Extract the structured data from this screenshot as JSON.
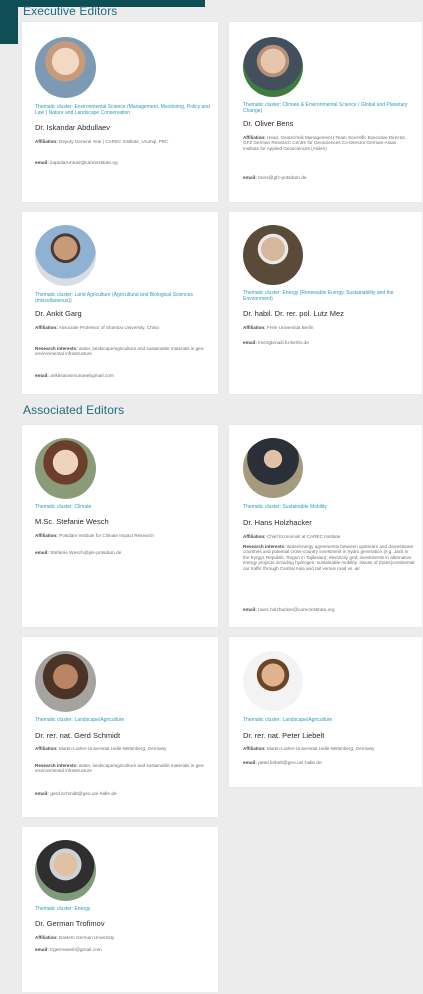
{
  "sections": {
    "executive": "Executive Editors",
    "associated": "Associated Editors"
  },
  "labels": {
    "affiliation": "Affiliation:",
    "research": "Research interests:",
    "email": "email:"
  },
  "editors": [
    {
      "cluster": "Thematic cluster: Environmental Science (Management, Monitoring, Policy and Law ) Nature and Landscape Conservation",
      "name": "Dr. Iskandar Abdullaev",
      "affiliation": "Deputy General Year | CAREC Institute, Urumqi, PRC",
      "research": "",
      "email": "iiapsdaAmtuniQlcareinstitute.og"
    },
    {
      "cluster": "Thematic cluster: Climate & Environmental Science / Global and Planetary Change)",
      "name": "Dr. Oliver Bens",
      "affiliation": "Head, Geotechnik Management | Team Scientific Executive Director, GFZ German Research Centre for Geosciences Co-Director German-Asian Institute for Applied Geosciences (Asilen)",
      "research": "",
      "email": "bens@gfz-potsdam.de"
    },
    {
      "cluster": "Thematic cluster: Land Agriculture (Agricultural and Biological Sciences (miscellaneous))",
      "name": "Dr. Ankit Garg",
      "affiliation": "Associate Professor of Shantou University, China",
      "research": "water, landscape/agriculture and sustainable materials in geo-environmental infrastructure",
      "email": "ankitsarasmunaeebgmail.com"
    },
    {
      "cluster": "Thematic cluster: Energy (Renewable Energy, Sustainability and the Environment)",
      "name": "Dr. habil. Dr. rer. pol. Lutz Mez",
      "affiliation": "Freie Universitat Berlin",
      "research": "",
      "email": "lmezgtenaiil.fu-berlin.de"
    },
    {
      "cluster": "Thematic cluster: Climate",
      "name": "M.Sc. Stefanie Wesch",
      "affiliation": "Potsdam Institute for Climate Impact Research",
      "research": "",
      "email": "Stefanie.Wesch@pik-potsdam.de"
    },
    {
      "cluster": "Thematic cluster: Sustainable Mobility",
      "name": "Dr. Hans Holzhacker",
      "affiliation": "Chief Economist at CAREC Institute",
      "research": "water/energy agreements between upstream and downstream countries and potential cross-country investment in hydro generation (e.g. Jack in the Kyrgyz Republic, Rogun in Tajikistan); electricity grid; investments in alternative energy projects including hydrogen; sustainable mobility: issues of (trans)continental car traffic through Central Asia and rail versus road vs. air",
      "email": "hans.holzhacker@carecinstitute.org"
    },
    {
      "cluster": "Thematic cluster: Landscape/Agriculture",
      "name": "Dr. rer. nat. Gerd Schmidt",
      "affiliation": "Martin-Luther-Universitat Halle-Wittenberg, Germany",
      "research": "water, landscape/agriculture and sustainable materials in geo-environmental infrastructure",
      "email": "gerd.schmidt@geo.uni-halle.de"
    },
    {
      "cluster": "Thematic cluster: Landscape/Agriculture",
      "name": "Dr. rer. nat. Peter Liebelt",
      "affiliation": "Martin-Luther-Universitat Halle-Wittenberg, Germany",
      "research": "",
      "email": "peter.liebelt@geo.uni-halle.de"
    },
    {
      "cluster": "Thematic cluster: Energy",
      "name": "Dr. German Trofimov",
      "affiliation": "Eastern German University",
      "research": "",
      "email": "trgermanetr@gmail.com"
    }
  ]
}
